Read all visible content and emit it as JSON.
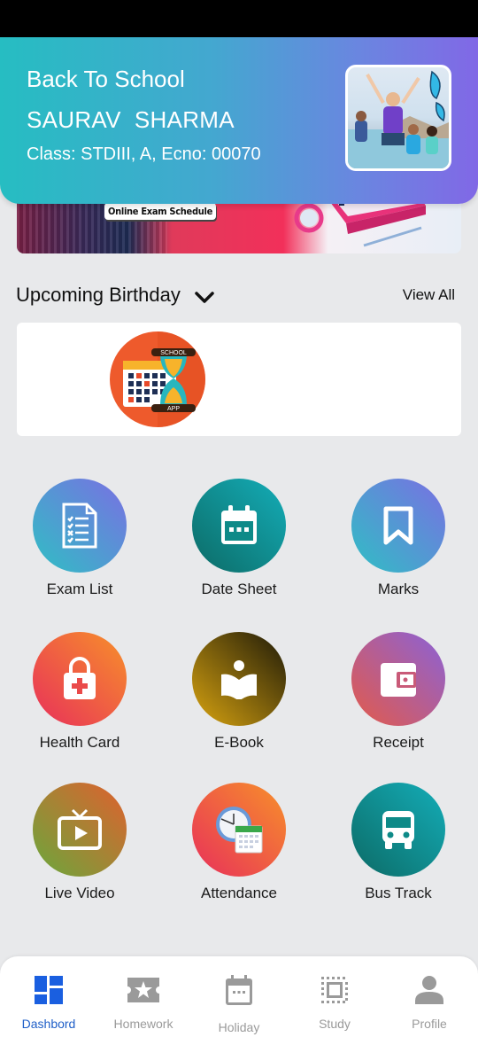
{
  "header": {
    "greeting": "Back To School",
    "student_name": "SAURAV  SHARMA",
    "class_info": "Class: STDIII, A, Ecno: 00070"
  },
  "banner": {
    "tag": "Online Exam Schedule"
  },
  "birthday": {
    "title": "Upcoming Birthday",
    "view_all": "View All",
    "logo_top": "SCHOOL",
    "logo_bottom": "APP"
  },
  "menu": [
    {
      "label": "Exam List",
      "icon": "exam-list-icon",
      "colors": [
        "#2fbfc4",
        "#7a6fe3"
      ]
    },
    {
      "label": "Date Sheet",
      "icon": "calendar-icon",
      "colors": [
        "#0c6b66",
        "#14adb8"
      ]
    },
    {
      "label": "Marks",
      "icon": "bookmark-icon",
      "colors": [
        "#2fbfc4",
        "#7a6fe3"
      ]
    },
    {
      "label": "Health Card",
      "icon": "medical-bag-icon",
      "colors": [
        "#e8305a",
        "#f7902a"
      ]
    },
    {
      "label": "E-Book",
      "icon": "book-reader-icon",
      "colors": [
        "#d9a410",
        "#1e1a08"
      ]
    },
    {
      "label": "Receipt",
      "icon": "wallet-icon",
      "colors": [
        "#e35a4a",
        "#8a62d8"
      ]
    },
    {
      "label": "Live Video",
      "icon": "tv-play-icon",
      "colors": [
        "#6aa83c",
        "#e0602e"
      ]
    },
    {
      "label": "Attendance",
      "icon": "clock-calendar-icon",
      "colors": [
        "#e8305a",
        "#f7902a"
      ]
    },
    {
      "label": "Bus Track",
      "icon": "bus-icon",
      "colors": [
        "#0c6b66",
        "#14adb8"
      ]
    }
  ],
  "bottom_nav": [
    {
      "label": "Dashbord",
      "icon": "dashboard-icon",
      "active": true
    },
    {
      "label": "Homework",
      "icon": "ticket-star-icon",
      "active": false
    },
    {
      "label": "Holiday",
      "icon": "calendar-icon",
      "active": false
    },
    {
      "label": "Study",
      "icon": "select-area-icon",
      "active": false
    },
    {
      "label": "Profile",
      "icon": "person-icon",
      "active": false
    }
  ],
  "colors": {
    "active_nav": "#1f5fc8",
    "inactive_nav": "#9a9a9a",
    "header_gradient_start": "#26bdc2",
    "header_gradient_end": "#8168e6"
  }
}
